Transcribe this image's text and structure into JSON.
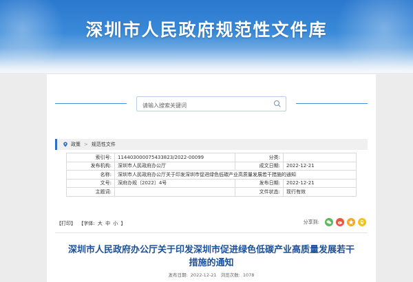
{
  "banner": {
    "title": "深圳市人民政府规范性文件库"
  },
  "search": {
    "placeholder": "请输入搜索关键词"
  },
  "breadcrumb": {
    "home": "政策",
    "separator": ">",
    "current": "规范性文件"
  },
  "meta": {
    "rows": [
      {
        "label1": "索引号:",
        "value1": "11440300007543382​3/2022-00099",
        "label2": "分类:",
        "value2": ""
      },
      {
        "label1": "发布机构:",
        "value1": "深圳市人民政府办公厅",
        "label2": "成文日期:",
        "value2": "2022-12-21"
      },
      {
        "label1": "名称:",
        "value1": "深圳市人民政府办公厅关于印发深圳市促进绿色低碳产业高质量发展若干措施的通知"
      },
      {
        "label1": "文号:",
        "value1": "深府办规〔2022〕4号",
        "label2": "发布日期:",
        "value2": "2022-12-21"
      },
      {
        "label1": "主题词:",
        "value1": "",
        "label2": "文件状态:",
        "value2": "现行有效"
      }
    ]
  },
  "toolbar": {
    "print": "【打印】",
    "font_label": "【字体:",
    "font_large": "大",
    "font_medium": "中",
    "font_small": "小",
    "font_close": "】",
    "share_label": "分享到:"
  },
  "colors": {
    "wechat": "#5cb85c",
    "weibo": "#e9573f",
    "qzone": "#f5a623",
    "qq": "#f0c419"
  },
  "document": {
    "title": "深圳市人民政府办公厅关于印发深圳市促进绿色低碳产业高质量发展若干措施的通知",
    "publish_label": "发布日期:",
    "publish_date": "2022-12-21",
    "views_label": "浏览次数:",
    "views": "1078"
  }
}
